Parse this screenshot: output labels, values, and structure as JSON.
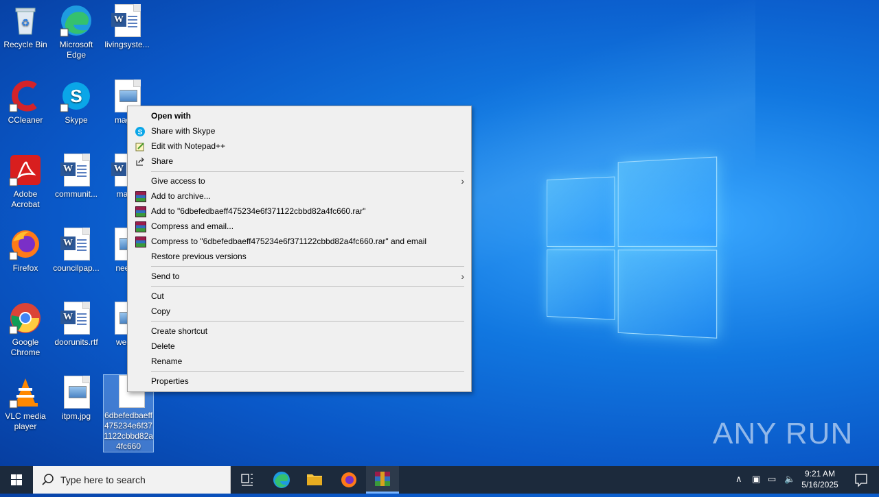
{
  "desktop_icons": [
    {
      "label": "Recycle Bin",
      "icon": "recycle-bin-icon"
    },
    {
      "label": "Microsoft Edge",
      "icon": "edge-icon"
    },
    {
      "label": "livingsyste...",
      "icon": "word-doc-icon"
    },
    {
      "label": "CCleaner",
      "icon": "ccleaner-icon"
    },
    {
      "label": "Skype",
      "icon": "skype-icon"
    },
    {
      "label": "magaz",
      "icon": "image-file-icon"
    },
    {
      "label": "Adobe Acrobat",
      "icon": "acrobat-icon"
    },
    {
      "label": "communit...",
      "icon": "word-doc-icon"
    },
    {
      "label": "matur",
      "icon": "word-doc-icon"
    },
    {
      "label": "Firefox",
      "icon": "firefox-icon"
    },
    {
      "label": "councilpap...",
      "icon": "word-doc-icon"
    },
    {
      "label": "neede",
      "icon": "image-file-icon"
    },
    {
      "label": "Google Chrome",
      "icon": "chrome-icon"
    },
    {
      "label": "doorunits.rtf",
      "icon": "word-doc-icon"
    },
    {
      "label": "weath",
      "icon": "image-file-icon"
    },
    {
      "label": "VLC media player",
      "icon": "vlc-icon"
    },
    {
      "label": "itpm.jpg",
      "icon": "image-file-icon"
    },
    {
      "label": "6dbefedbaeff475234e6f371122cbbd82a4fc660",
      "icon": "blank-file-icon"
    }
  ],
  "context_menu": {
    "open_with": "Open with",
    "share_skype": "Share with Skype",
    "edit_notepad": "Edit with Notepad++",
    "share": "Share",
    "give_access": "Give access to",
    "add_archive": "Add to archive...",
    "add_to_rar": "Add to \"6dbefedbaeff475234e6f371122cbbd82a4fc660.rar\"",
    "compress_email": "Compress and email...",
    "compress_to_rar_email": "Compress to \"6dbefedbaeff475234e6f371122cbbd82a4fc660.rar\" and email",
    "restore": "Restore previous versions",
    "send_to": "Send to",
    "cut": "Cut",
    "copy": "Copy",
    "create_shortcut": "Create shortcut",
    "delete": "Delete",
    "rename": "Rename",
    "properties": "Properties"
  },
  "taskbar": {
    "search_placeholder": "Type here to search",
    "time": "9:21 AM",
    "date": "5/16/2025"
  },
  "watermark": "ANY RUN"
}
